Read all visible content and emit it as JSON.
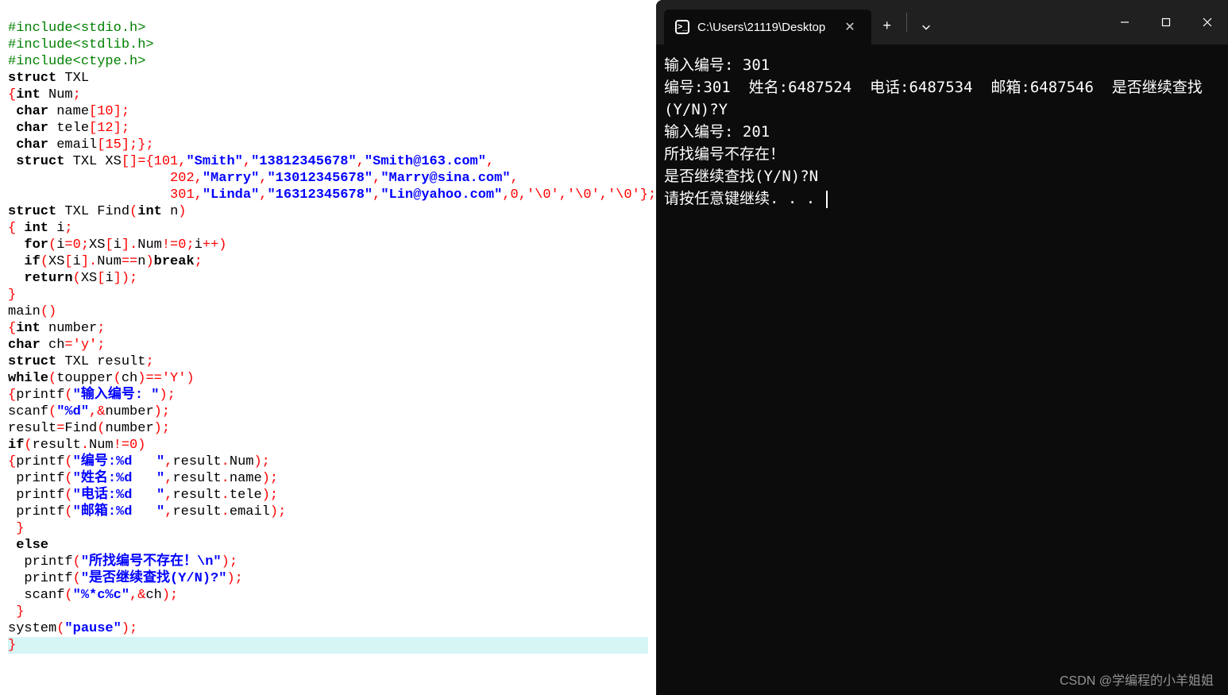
{
  "editor": {
    "includes": [
      "#include<stdio.h>",
      "#include<stdlib.h>",
      "#include<ctype.h>"
    ],
    "struct_decl": "struct TXL",
    "fields": {
      "num": "int Num;",
      "name": "char name[10];",
      "tele": "char tele[12];",
      "email": "char email[15];};"
    },
    "array_decl": "struct TXL XS[]={",
    "array_data": [
      {
        "id": "101",
        "name": "\"Smith\"",
        "tele": "\"13812345678\"",
        "email": "\"Smith@163.com\""
      },
      {
        "id": "202",
        "name": "\"Marry\"",
        "tele": "\"13012345678\"",
        "email": "\"Marry@sina.com\""
      },
      {
        "id": "301",
        "name": "\"Linda\"",
        "tele": "\"16312345678\"",
        "email": "\"Lin@yahoo.com\""
      }
    ],
    "array_tail": ",0,'\\0','\\0','\\0'};",
    "find_sig": "struct TXL Find(int n)",
    "find_body": {
      "l1": "{ int i;",
      "l2": "for(i=0;XS[i].Num!=0;i++)",
      "l3": "if(XS[i].Num==n)break;",
      "l4": "return(XS[i]);",
      "l5": "}"
    },
    "main_sig": "main()",
    "main_body": {
      "l1": "{int number;",
      "l2": "char ch='y';",
      "l3": "struct TXL result;",
      "l4": "while(toupper(ch)=='Y')",
      "l5_pre": "{printf(",
      "l5_str": "\"输入编号: \"",
      "l5_post": ");",
      "l6": "scanf(\"%d\",&number);",
      "l7": "result=Find(number);",
      "l8": "if(result.Num!=0)",
      "l9_pre": "{printf(",
      "l9_str": "\"编号:%d   \"",
      "l9_post": ",result.Num);",
      "l10_pre": " printf(",
      "l10_str": "\"姓名:%d   \"",
      "l10_post": ",result.name);",
      "l11_pre": " printf(",
      "l11_str": "\"电话:%d   \"",
      "l11_post": ",result.tele);",
      "l12_pre": " printf(",
      "l12_str": "\"邮箱:%d   \"",
      "l12_post": ",result.email);",
      "l13": " }",
      "l14": " else",
      "l15_pre": "  printf(",
      "l15_str": "\"所找编号不存在！\\n\"",
      "l15_post": ");",
      "l16_pre": "  printf(",
      "l16_str": "\"是否继续查找(Y/N)?\"",
      "l16_post": ");",
      "l17_pre": "  scanf(",
      "l17_str": "\"%*c%c\"",
      "l17_post": ",&ch);",
      "l18": " }",
      "l19_pre": "system(",
      "l19_str": "\"pause\"",
      "l19_post": ");",
      "l20": "}"
    }
  },
  "terminal": {
    "tab_title": "C:\\Users\\21119\\Desktop",
    "new_tab_plus": "+",
    "output": {
      "l1": "输入编号: 301",
      "l2": "编号:301  姓名:6487524  电话:6487534  邮箱:6487546  是否继续查找(Y/N)?Y",
      "l3": "输入编号: 201",
      "l4": "所找编号不存在！",
      "l5": "是否继续查找(Y/N)?N",
      "l6": "请按任意键继续. . . "
    }
  },
  "watermark": "CSDN @学编程的小羊姐姐"
}
